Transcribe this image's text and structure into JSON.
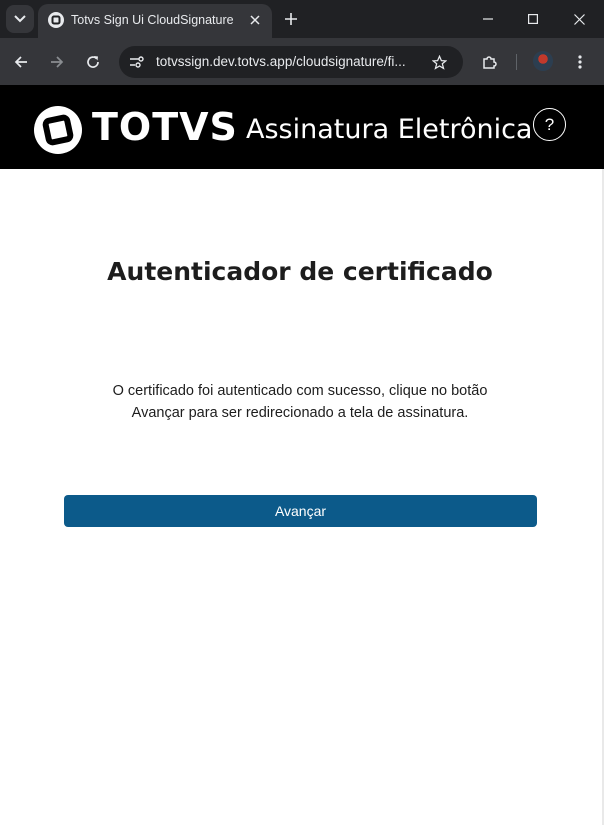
{
  "browser": {
    "tab_title": "Totvs Sign Ui CloudSignature",
    "url": "totvssign.dev.totvs.app/cloudsignature/fi..."
  },
  "header": {
    "logo_text": "TOTVS",
    "title": "Assinatura Eletrônica",
    "help_label": "?"
  },
  "main": {
    "title": "Autenticador de certificado",
    "message": "O certificado foi autenticado com sucesso, clique no botão Avançar para ser redirecionado a tela de assinatura.",
    "button_label": "Avançar"
  },
  "colors": {
    "header_bg": "#000000",
    "button_bg": "#0c5a8a"
  },
  "icons": [
    "tab-list-icon",
    "totvs-favicon-icon",
    "close-icon",
    "plus-icon",
    "minimize-icon",
    "maximize-icon",
    "window-close-icon",
    "back-icon",
    "forward-icon",
    "reload-icon",
    "site-info-icon",
    "star-icon",
    "extensions-icon",
    "menu-icon",
    "totvs-logo-icon",
    "help-icon"
  ]
}
